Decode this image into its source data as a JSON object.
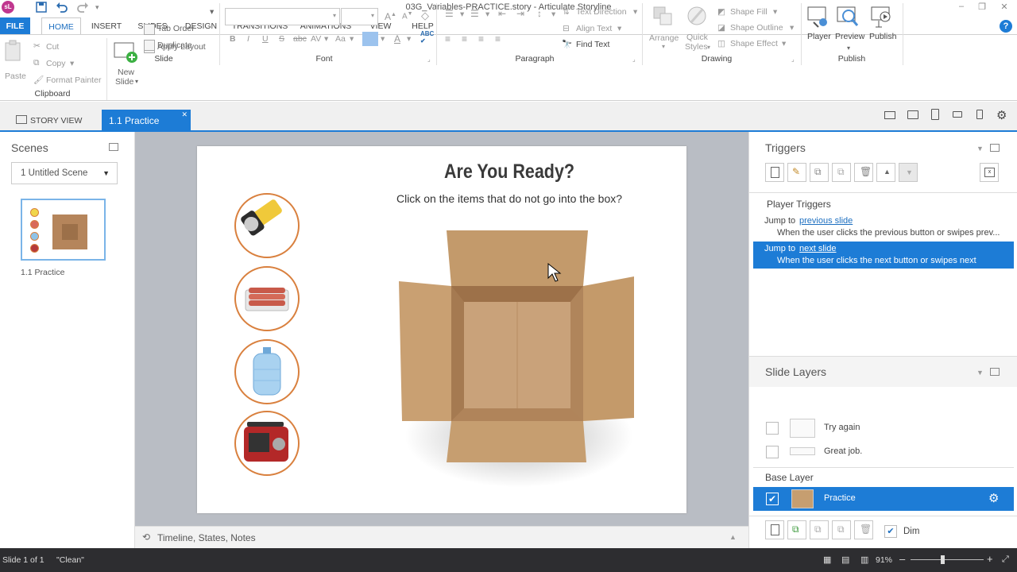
{
  "window": {
    "title": "03G_Variables-PRACTICE.story - Articulate Storyline",
    "app_badge": "sL"
  },
  "menu": {
    "tabs": [
      "FILE",
      "HOME",
      "INSERT",
      "SLIDES",
      "DESIGN",
      "TRANSITIONS",
      "ANIMATIONS",
      "VIEW",
      "HELP"
    ],
    "active": "HOME"
  },
  "ribbon": {
    "clipboard": {
      "paste": "Paste",
      "cut": "Cut",
      "copy": "Copy",
      "format_painter": "Format Painter",
      "label": "Clipboard"
    },
    "slide": {
      "new_slide_line1": "New",
      "new_slide_line2": "Slide",
      "apply_layout": "Apply Layout",
      "tab_order": "Tab Order",
      "duplicate": "Duplicate",
      "label": "Slide"
    },
    "font": {
      "label": "Font",
      "bold": "B",
      "italic": "I",
      "underline": "U",
      "strike": "S",
      "abc": "abc",
      "av": "AV",
      "aa": "Aa"
    },
    "paragraph": {
      "text_direction": "Text Direction",
      "align_text": "Align Text",
      "find_text": "Find Text",
      "label": "Paragraph"
    },
    "drawing": {
      "arrange": "Arrange",
      "quick_styles_line1": "Quick",
      "quick_styles_line2": "Styles",
      "shape_fill": "Shape Fill",
      "shape_outline": "Shape Outline",
      "shape_effect": "Shape Effect",
      "label": "Drawing"
    },
    "publish": {
      "player": "Player",
      "preview": "Preview",
      "publish": "Publish",
      "label": "Publish"
    }
  },
  "story_tabs": {
    "story_view": "STORY VIEW",
    "active_tab": "1.1 Practice"
  },
  "scenes": {
    "title": "Scenes",
    "selected_scene": "1 Untitled Scene",
    "thumb_label": "1.1 Practice"
  },
  "slide": {
    "title": "Are You Ready?",
    "subtitle": "Click on the items that do not go into the box?"
  },
  "timeline": {
    "label": "Timeline, States, Notes"
  },
  "triggers": {
    "title": "Triggers",
    "section": "Player Triggers",
    "items": [
      {
        "action": "Jump to",
        "target": "previous slide",
        "condition": "When the user clicks the previous button or swipes prev..."
      },
      {
        "action": "Jump to",
        "target": "next slide",
        "condition": "When the user clicks the next button or swipes next"
      }
    ]
  },
  "layers": {
    "title": "Slide Layers",
    "items": [
      {
        "name": "Try again"
      },
      {
        "name": "Great job."
      }
    ],
    "base_label": "Base Layer",
    "base_name": "Practice",
    "dim_label": "Dim"
  },
  "status": {
    "slide_info": "Slide 1 of 1",
    "state": "\"Clean\"",
    "zoom": "91%"
  },
  "colors": {
    "accent": "#1d7cd6",
    "status_bg": "#2d2d30",
    "canvas": "#b9bdc4",
    "circle_border": "#d9803e"
  }
}
